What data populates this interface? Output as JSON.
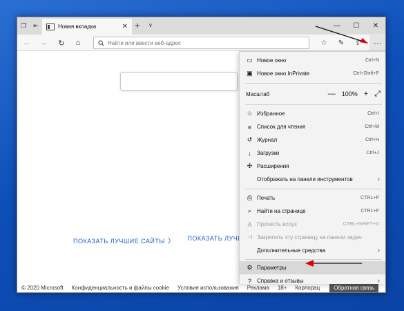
{
  "tab": {
    "title": "Новая вкладка"
  },
  "window_buttons": {
    "minimize": "—",
    "maximize": "☐",
    "close": "✕"
  },
  "address": {
    "placeholder": "Найти или ввести веб-адрес"
  },
  "more_button": "···",
  "page": {
    "top_sites": [
      "ПОКАЗАТЬ ЛУЧШИЕ САЙТЫ",
      "ПОКАЗАТЬ ЛУЧШИ"
    ],
    "footer": [
      "© 2020 Microsoft",
      "Конфиденциальность и файлы cookie",
      "Условия использования",
      "Реклама",
      "18+",
      "Корпорац"
    ],
    "feedback": "Обратная связь"
  },
  "menu": {
    "new_window": {
      "label": "Новое окно",
      "shortcut": "Ctrl+N"
    },
    "new_private": {
      "label": "Новое окно InPrivate",
      "shortcut": "Ctrl+Shift+P"
    },
    "zoom": {
      "label": "Масштаб",
      "minus": "—",
      "value": "100%",
      "plus": "+"
    },
    "favorites": {
      "label": "Избранное",
      "shortcut": "Ctrl+I"
    },
    "reading_list": {
      "label": "Список для чтения",
      "shortcut": "Ctrl+M"
    },
    "history": {
      "label": "Журнал",
      "shortcut": "Ctrl+H"
    },
    "downloads": {
      "label": "Загрузки",
      "shortcut": "Ctrl+J"
    },
    "extensions": {
      "label": "Расширения"
    },
    "show_toolbar": {
      "label": "Отображать на панели инструментов"
    },
    "print": {
      "label": "Печать",
      "shortcut": "CTRL+P"
    },
    "find": {
      "label": "Найти на странице",
      "shortcut": "CTRL+F"
    },
    "read_aloud": {
      "label": "Прочесть вслух",
      "shortcut": "CTRL+SHIFT+G"
    },
    "pin_taskbar": {
      "label": "Закрепить эту страницу на панели задач"
    },
    "more_tools": {
      "label": "Дополнительные средства"
    },
    "settings": {
      "label": "Параметры"
    },
    "help": {
      "label": "Справка и отзывы"
    }
  },
  "colors": {
    "accent_link": "#1f5fbf",
    "annotation_arrow": "#e00000",
    "desktop": "#0d4fb8"
  }
}
